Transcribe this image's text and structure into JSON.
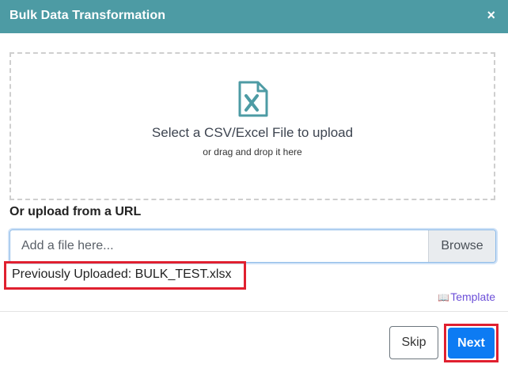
{
  "modal": {
    "title": "Bulk Data Transformation",
    "close_glyph": "×"
  },
  "dropzone": {
    "icon": "excel-file-icon",
    "title": "Select a CSV/Excel File to upload",
    "subtitle": "or drag and drop it here"
  },
  "url_section": {
    "label": "Or upload from a URL",
    "input_placeholder": "Add a file here...",
    "input_value": "",
    "browse_label": "Browse"
  },
  "previous_upload": {
    "text": "Previously Uploaded: BULK_TEST.xlsx"
  },
  "template": {
    "icon": "book-icon",
    "label": "Template"
  },
  "footer": {
    "skip_label": "Skip",
    "next_label": "Next"
  },
  "colors": {
    "header": "#4d9ba4",
    "primary": "#0d7bf3",
    "highlight": "#e0202f",
    "link": "#6c4fd8"
  }
}
